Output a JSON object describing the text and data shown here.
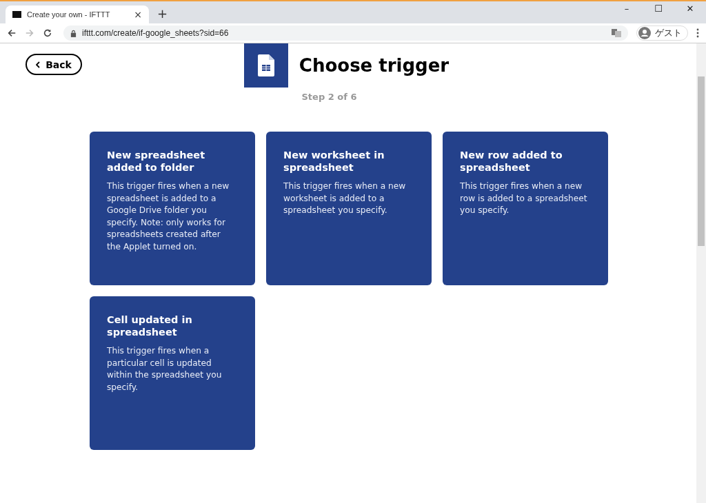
{
  "browser": {
    "tab_title": "Create your own - IFTTT",
    "tab_close": "×",
    "new_tab": "+",
    "url": "ifttt.com/create/if-google_sheets?sid=66",
    "profile": "ゲスト",
    "window_controls": [
      "–",
      "☐",
      "✕"
    ]
  },
  "page": {
    "back": "Back",
    "title": "Choose trigger",
    "step": "Step 2 of 6"
  },
  "triggers": [
    {
      "title": "New spreadsheet added to folder",
      "description": "This trigger fires when a new spreadsheet is added to a Google Drive folder you specify. Note: only works for spreadsheets created after the Applet turned on."
    },
    {
      "title": "New worksheet in spreadsheet",
      "description": "This trigger fires when a new worksheet is added to a spreadsheet you specify."
    },
    {
      "title": "New row added to spreadsheet",
      "description": "This trigger fires when a new row is added to a spreadsheet you specify."
    },
    {
      "title": "Cell updated in spreadsheet",
      "description": "This trigger fires when a particular cell is updated within the spreadsheet you specify."
    }
  ]
}
